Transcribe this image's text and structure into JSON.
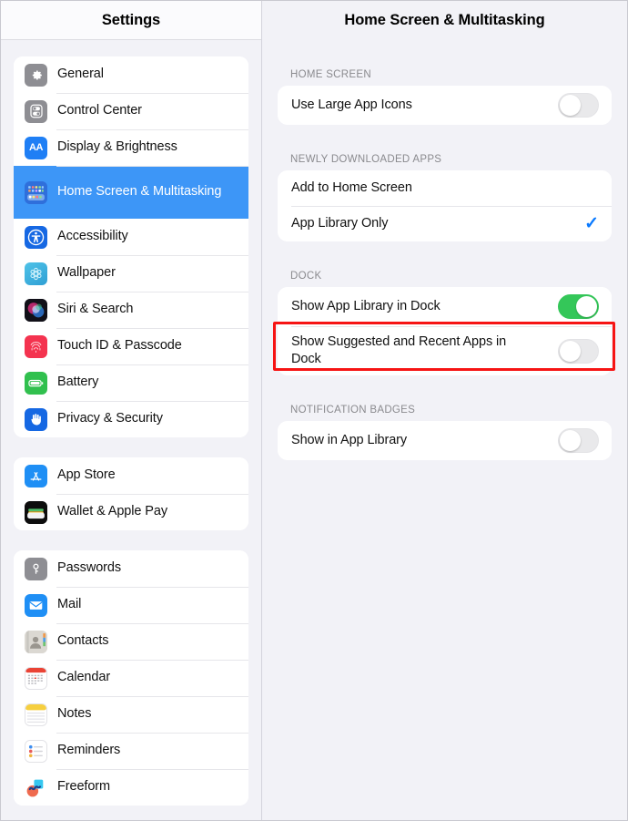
{
  "sidebar": {
    "title": "Settings",
    "groups": [
      {
        "items": [
          {
            "label": "General",
            "icon": "gear-icon",
            "selected": false
          },
          {
            "label": "Control Center",
            "icon": "control-center-icon",
            "selected": false
          },
          {
            "label": "Display & Brightness",
            "icon": "display-brightness-icon",
            "selected": false
          },
          {
            "label": "Home Screen & Multitasking",
            "icon": "home-screen-icon",
            "selected": true
          },
          {
            "label": "Accessibility",
            "icon": "accessibility-icon",
            "selected": false
          },
          {
            "label": "Wallpaper",
            "icon": "wallpaper-icon",
            "selected": false
          },
          {
            "label": "Siri & Search",
            "icon": "siri-icon",
            "selected": false
          },
          {
            "label": "Touch ID & Passcode",
            "icon": "touch-id-icon",
            "selected": false
          },
          {
            "label": "Battery",
            "icon": "battery-icon",
            "selected": false
          },
          {
            "label": "Privacy & Security",
            "icon": "privacy-security-icon",
            "selected": false
          }
        ]
      },
      {
        "items": [
          {
            "label": "App Store",
            "icon": "app-store-icon",
            "selected": false
          },
          {
            "label": "Wallet & Apple Pay",
            "icon": "wallet-icon",
            "selected": false
          }
        ]
      },
      {
        "items": [
          {
            "label": "Passwords",
            "icon": "passwords-icon",
            "selected": false
          },
          {
            "label": "Mail",
            "icon": "mail-icon",
            "selected": false
          },
          {
            "label": "Contacts",
            "icon": "contacts-icon",
            "selected": false
          },
          {
            "label": "Calendar",
            "icon": "calendar-icon",
            "selected": false
          },
          {
            "label": "Notes",
            "icon": "notes-icon",
            "selected": false
          },
          {
            "label": "Reminders",
            "icon": "reminders-icon",
            "selected": false
          },
          {
            "label": "Freeform",
            "icon": "freeform-icon",
            "selected": false
          }
        ]
      }
    ]
  },
  "detail": {
    "title": "Home Screen & Multitasking",
    "sections": [
      {
        "header": "HOME SCREEN",
        "rows": [
          {
            "label": "Use Large App Icons",
            "control": "toggle",
            "value": "off"
          }
        ]
      },
      {
        "header": "NEWLY DOWNLOADED APPS",
        "rows": [
          {
            "label": "Add to Home Screen",
            "control": "none",
            "value": ""
          },
          {
            "label": "App Library Only",
            "control": "check",
            "value": "checked"
          }
        ]
      },
      {
        "header": "DOCK",
        "rows": [
          {
            "label": "Show App Library in Dock",
            "control": "toggle",
            "value": "on"
          },
          {
            "label": "Show Suggested and Recent Apps in Dock",
            "control": "toggle",
            "value": "off",
            "highlighted": true
          }
        ]
      },
      {
        "header": "NOTIFICATION BADGES",
        "rows": [
          {
            "label": "Show in App Library",
            "control": "toggle",
            "value": "off"
          }
        ]
      }
    ]
  },
  "colors": {
    "accent_blue": "#3d96f7",
    "check_blue": "#0a7aff",
    "toggle_on_green": "#34c759",
    "toggle_off_gray": "#e9e9eb",
    "highlight_red": "#f61414",
    "background": "#f2f2f7",
    "card": "#ffffff"
  },
  "checkmark_glyph": "✓"
}
